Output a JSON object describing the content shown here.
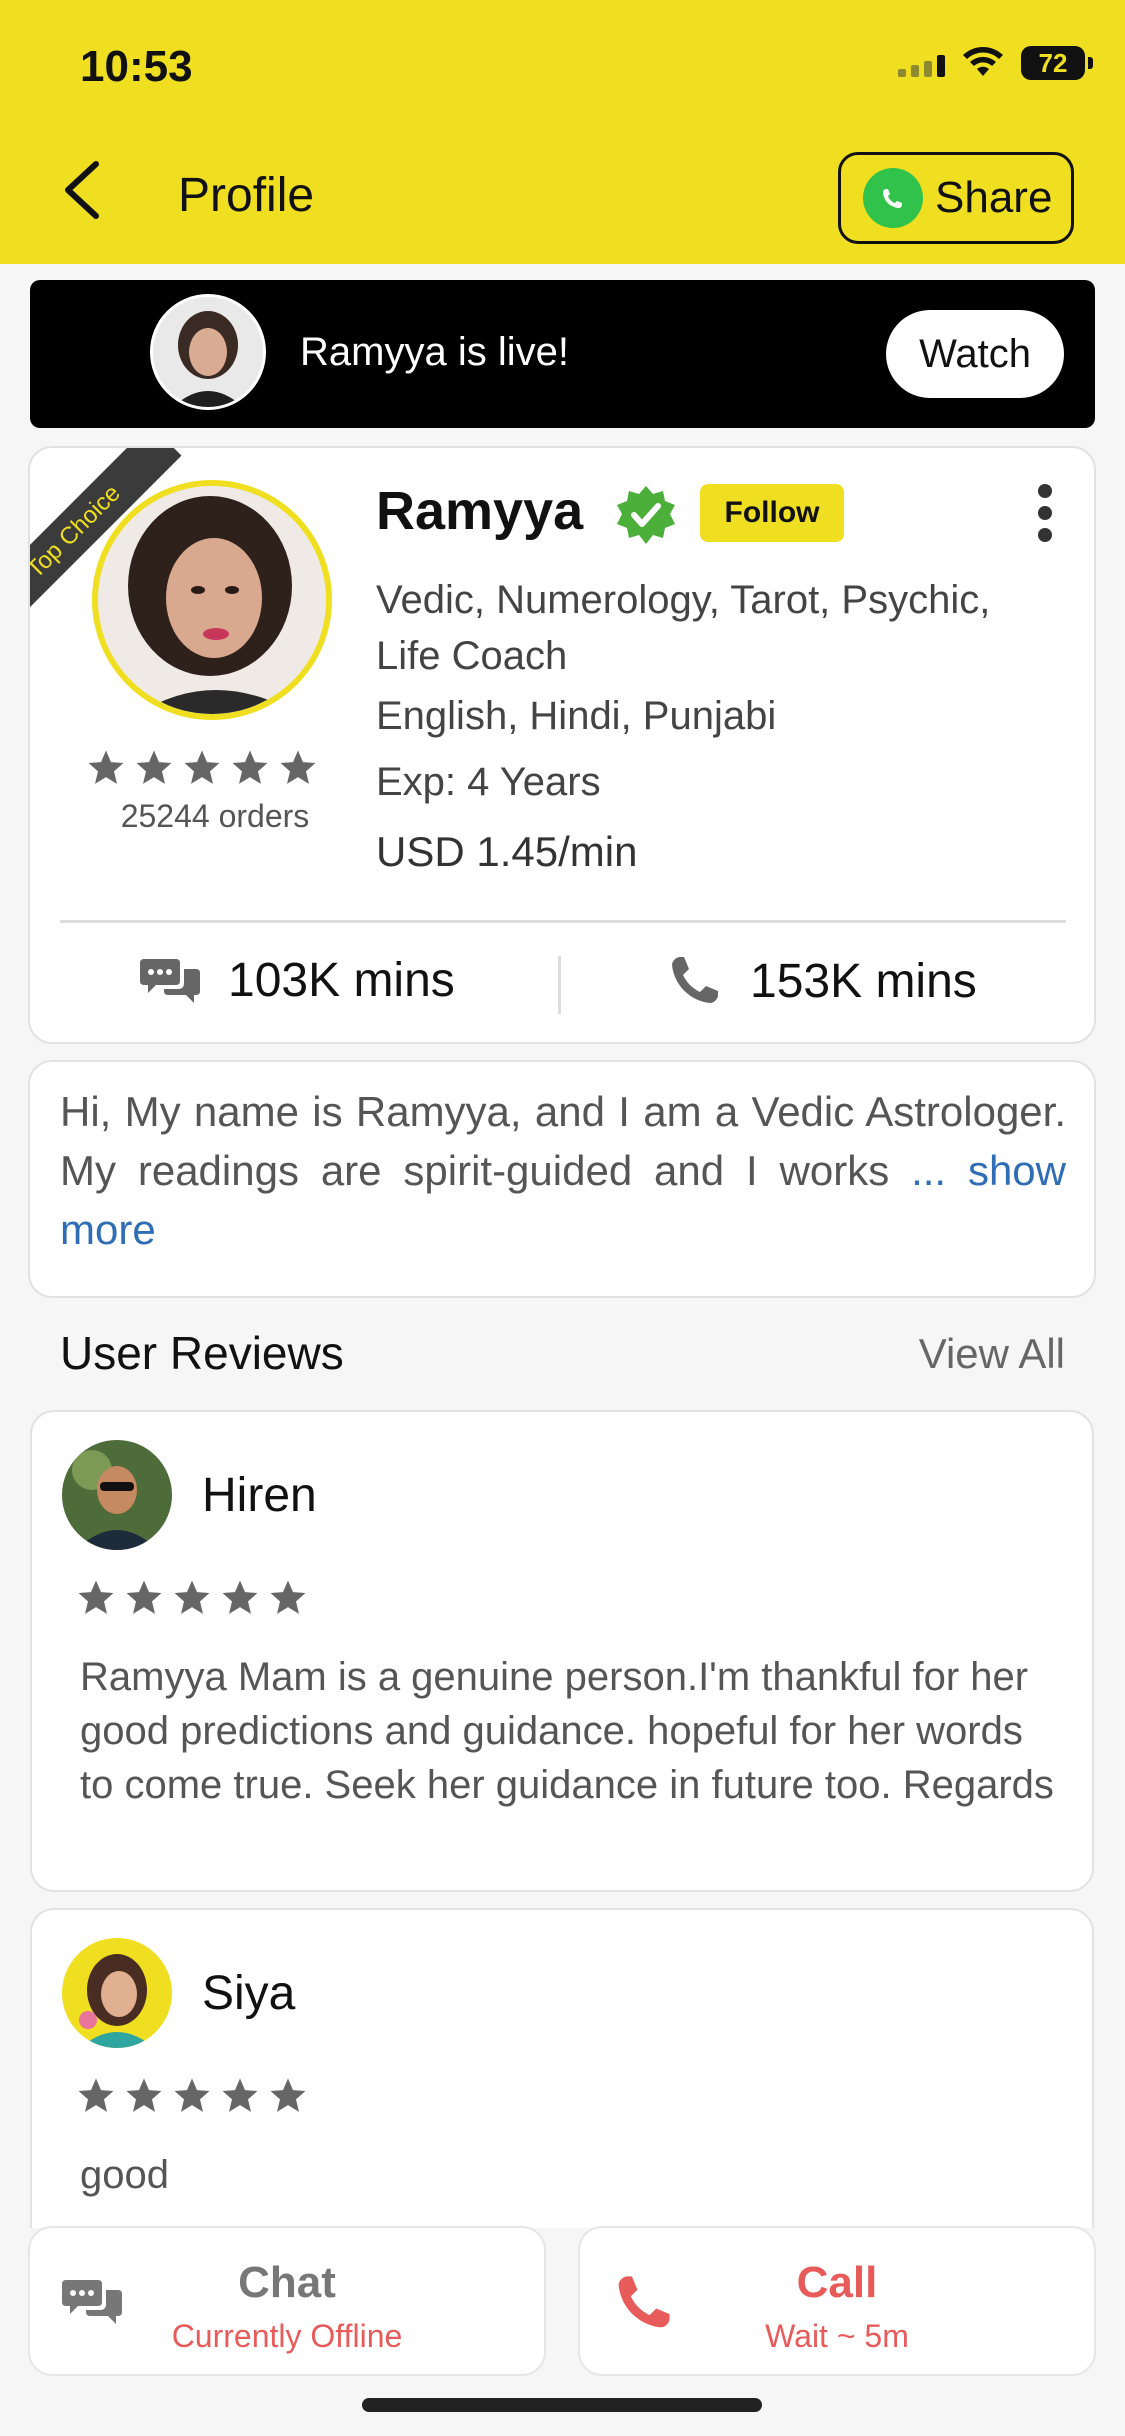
{
  "status_bar": {
    "time": "10:53",
    "battery": "72"
  },
  "header": {
    "title": "Profile",
    "share_label": "Share"
  },
  "live_banner": {
    "text": "Ramyya is live!",
    "watch_label": "Watch"
  },
  "profile": {
    "ribbon": "Top Choice",
    "name": "Ramyya",
    "follow_label": "Follow",
    "skills": "Vedic, Numerology, Tarot, Psychic, Life Coach",
    "languages": "English, Hindi, Punjabi",
    "experience": "Exp: 4 Years",
    "price": "USD 1.45/min",
    "rating_stars": 5,
    "orders": "25244 orders",
    "chat_minutes": "103K mins",
    "call_minutes": "153K mins"
  },
  "bio": {
    "text": "Hi, My name is Ramyya, and I am a Vedic Astrologer. My readings are spirit-guided and I works",
    "more": "... show more"
  },
  "reviews": {
    "title": "User Reviews",
    "view_all": "View All",
    "items": [
      {
        "name": "Hiren",
        "stars": 5,
        "text": "Ramyya Mam is a genuine person.I'm thankful for her good predictions and guidance. hopeful for her words to come true. Seek her guidance in future too. Regards"
      },
      {
        "name": "Siya",
        "stars": 5,
        "text": "good"
      }
    ]
  },
  "actions": {
    "chat": {
      "label": "Chat",
      "status": "Currently Offline"
    },
    "call": {
      "label": "Call",
      "status": "Wait ~ 5m"
    }
  },
  "colors": {
    "accent": "#f0df20",
    "call_red": "#e85b5b",
    "link_blue": "#2f6db5",
    "verified_green": "#4caf3a",
    "whatsapp_green": "#31c24b"
  }
}
